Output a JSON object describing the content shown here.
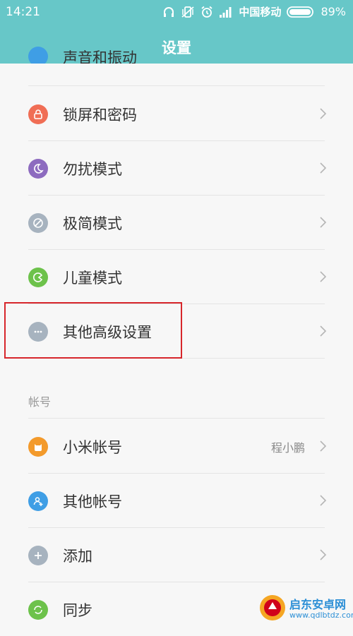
{
  "status_bar": {
    "time": "14:21",
    "carrier": "中国移动",
    "battery_percent": "89%",
    "icons": [
      "headphones-icon",
      "vibrate-off-icon",
      "alarm-icon",
      "signal-icon",
      "battery-icon"
    ]
  },
  "header": {
    "title": "设置"
  },
  "partial_item": {
    "label": "声音和振动",
    "icon": "sound-icon"
  },
  "items": [
    {
      "label": "锁屏和密码",
      "icon": "lock-icon",
      "color": "#f06e55"
    },
    {
      "label": "勿扰模式",
      "icon": "moon-icon",
      "color": "#8d6bbf"
    },
    {
      "label": "极简模式",
      "icon": "compass-icon",
      "color": "#a7b3bf"
    },
    {
      "label": "儿童模式",
      "icon": "kid-icon",
      "color": "#6dc24b"
    },
    {
      "label": "其他高级设置",
      "icon": "more-icon",
      "color": "#a7b3bf"
    }
  ],
  "account_section": {
    "header": "帐号",
    "items": [
      {
        "label": "小米帐号",
        "value": "程小鹏",
        "icon": "mi-icon",
        "color": "#f39a2b"
      },
      {
        "label": "其他帐号",
        "icon": "user-add-icon",
        "color": "#3f9ee5"
      },
      {
        "label": "添加",
        "icon": "plus-icon",
        "color": "#a7b3bf"
      },
      {
        "label": "同步",
        "icon": "sync-icon",
        "color": "#6dc24b"
      }
    ]
  },
  "watermark": {
    "name": "启东安卓网",
    "url": "www.qdlbtdz.com"
  },
  "colors": {
    "header": "#67c7c8",
    "highlight": "#d7262b",
    "background": "#f7f7f7"
  }
}
